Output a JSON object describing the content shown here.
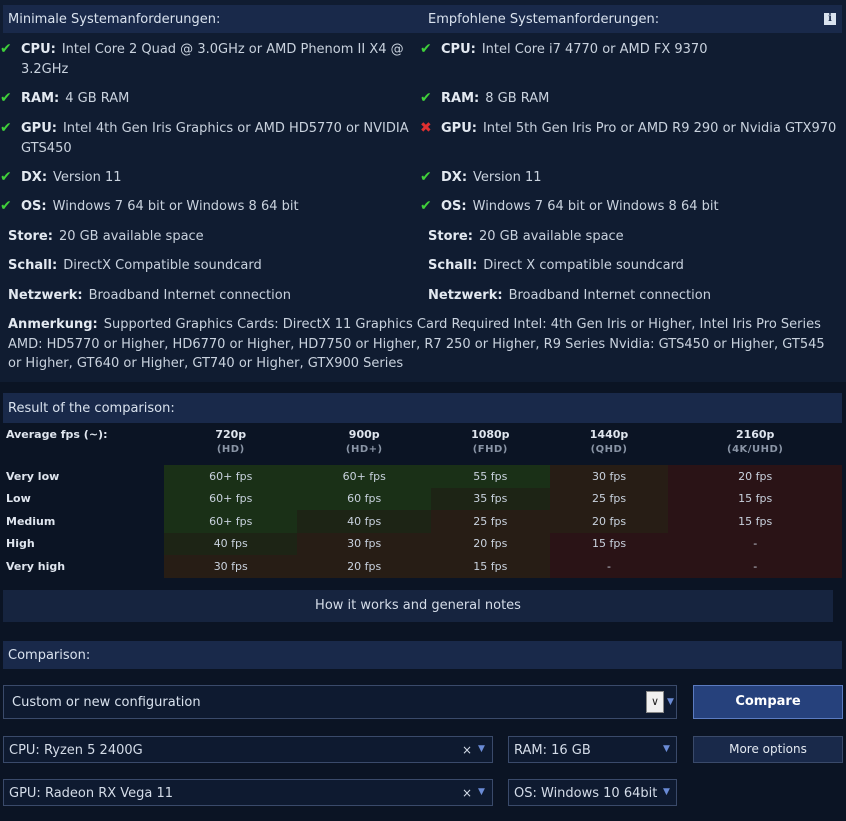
{
  "requirements": {
    "min_header": "Minimale Systemanforderungen:",
    "rec_header": "Empfohlene Systemanforderungen:",
    "info_icon": "i",
    "min": [
      {
        "label": "CPU:",
        "value": "Intel Core 2 Quad @ 3.0GHz or AMD Phenom II X4 @ 3.2GHz",
        "status": "ok"
      },
      {
        "label": "RAM:",
        "value": "4 GB RAM",
        "status": "ok"
      },
      {
        "label": "GPU:",
        "value": "Intel 4th Gen Iris Graphics or AMD HD5770 or NVIDIA GTS450",
        "status": "ok"
      },
      {
        "label": "DX:",
        "value": "Version 11",
        "status": "ok"
      },
      {
        "label": "OS:",
        "value": "Windows 7 64 bit or Windows 8 64 bit",
        "status": "ok"
      },
      {
        "label": "Store:",
        "value": "20 GB available space",
        "status": "none"
      },
      {
        "label": "Schall:",
        "value": "DirectX Compatible soundcard",
        "status": "none"
      },
      {
        "label": "Netzwerk:",
        "value": "Broadband Internet connection",
        "status": "none"
      }
    ],
    "rec": [
      {
        "label": "CPU:",
        "value": "Intel Core i7 4770 or AMD FX 9370",
        "status": "ok"
      },
      {
        "label": "RAM:",
        "value": "8 GB RAM",
        "status": "ok"
      },
      {
        "label": "GPU:",
        "value": "Intel 5th Gen Iris Pro or AMD R9 290 or Nvidia GTX970",
        "status": "bad"
      },
      {
        "label": "DX:",
        "value": "Version 11",
        "status": "ok"
      },
      {
        "label": "OS:",
        "value": "Windows 7 64 bit or Windows 8 64 bit",
        "status": "ok"
      },
      {
        "label": "Store:",
        "value": "20 GB available space",
        "status": "none"
      },
      {
        "label": "Schall:",
        "value": "Direct X compatible soundcard",
        "status": "none"
      },
      {
        "label": "Netzwerk:",
        "value": "Broadband Internet connection",
        "status": "none"
      }
    ],
    "note_label": "Anmerkung:",
    "note_text": "Supported Graphics Cards: DirectX 11 Graphics Card Required Intel: 4th Gen Iris or Higher, Intel Iris Pro Series AMD: HD5770 or Higher, HD6770 or Higher, HD7750 or Higher, R7 250 or Higher, R9 Series Nvidia: GTS450 or Higher, GT545 or Higher, GT640 or Higher, GT740 or Higher, GTX900 Series"
  },
  "result": {
    "header": "Result of the comparison:",
    "corner_label": "Average fps (~):",
    "resolutions": [
      {
        "name": "720p",
        "sub": "(HD)"
      },
      {
        "name": "900p",
        "sub": "(HD+)"
      },
      {
        "name": "1080p",
        "sub": "(FHD)"
      },
      {
        "name": "1440p",
        "sub": "(QHD)"
      },
      {
        "name": "2160p",
        "sub": "(4K/UHD)"
      }
    ],
    "rows": [
      {
        "label": "Very low",
        "cells": [
          "60+ fps",
          "60+ fps",
          "55 fps",
          "30 fps",
          "20 fps"
        ],
        "levels": [
          3,
          3,
          3,
          1,
          0
        ]
      },
      {
        "label": "Low",
        "cells": [
          "60+ fps",
          "60 fps",
          "35 fps",
          "25 fps",
          "15 fps"
        ],
        "levels": [
          3,
          3,
          2,
          1,
          0
        ]
      },
      {
        "label": "Medium",
        "cells": [
          "60+ fps",
          "40 fps",
          "25 fps",
          "20 fps",
          "15 fps"
        ],
        "levels": [
          3,
          2,
          1,
          1,
          0
        ]
      },
      {
        "label": "High",
        "cells": [
          "40 fps",
          "30 fps",
          "20 fps",
          "15 fps",
          "-"
        ],
        "levels": [
          2,
          1,
          1,
          0,
          0
        ]
      },
      {
        "label": "Very high",
        "cells": [
          "30 fps",
          "20 fps",
          "15 fps",
          "-",
          "-"
        ],
        "levels": [
          1,
          1,
          1,
          0,
          0
        ]
      }
    ],
    "level_colors": [
      "#2a1316",
      "#271d15",
      "#1d2415",
      "#1a3017"
    ]
  },
  "how_button": "How it works and general notes",
  "comparison": {
    "header": "Comparison:",
    "config_value": "Custom or new configuration",
    "compare_button": "Compare",
    "cpu_value": "CPU: Ryzen 5 2400G",
    "ram_value": "RAM: 16 GB",
    "more_button": "More options",
    "gpu_value": "GPU: Radeon RX Vega 11",
    "os_value": "OS: Windows 10 64bit",
    "clear_glyph": "×",
    "caret_glyph": "▼"
  }
}
